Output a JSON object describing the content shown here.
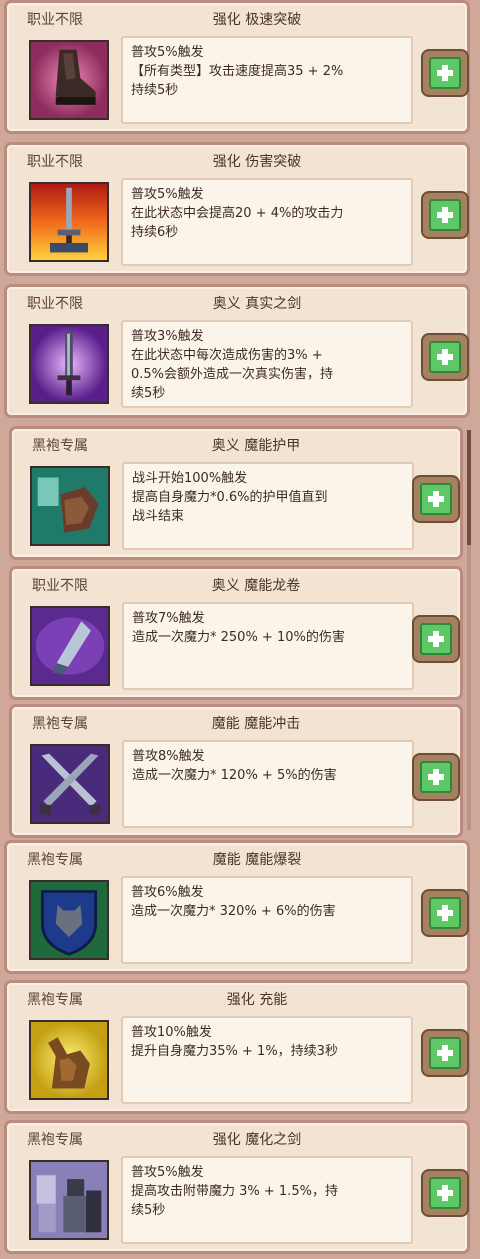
{
  "skills": [
    {
      "class_label": "职业不限",
      "title": "强化 极速突破",
      "desc": "普攻5%触发\n【所有类型】攻击速度提高35 + 2%\n持续5秒",
      "icon": "boot-icon",
      "add_label": "+"
    },
    {
      "class_label": "职业不限",
      "title": "强化 伤害突破",
      "desc": "普攻5%触发\n在此状态中会提高20 + 4%的攻击力\n持续6秒",
      "icon": "sword-in-fire-icon",
      "add_label": "+"
    },
    {
      "class_label": "职业不限",
      "title": "奥义 真实之剑",
      "desc": "普攻3%触发\n在此状态中每次造成伤害的3% +\n0.5%会额外造成一次真实伤害，持\n续5秒",
      "icon": "glowing-sword-icon",
      "add_label": "+"
    },
    {
      "class_label": "黑袍专属",
      "title": "奥义 魔能护甲",
      "desc": "战斗开始100%触发\n提高自身魔力*0.6%的护甲值直到\n战斗结束",
      "icon": "magic-armor-icon",
      "add_label": "+"
    },
    {
      "class_label": "职业不限",
      "title": "奥义 魔能龙卷",
      "desc": "普攻7%触发\n造成一次魔力* 250% + 10%的伤害",
      "icon": "tornado-crystal-icon",
      "add_label": "+"
    },
    {
      "class_label": "黑袍专属",
      "title": "魔能 魔能冲击",
      "desc": "普攻8%触发\n造成一次魔力* 120% + 5%的伤害",
      "icon": "crossed-swords-icon",
      "add_label": "+"
    },
    {
      "class_label": "黑袍专属",
      "title": "魔能 魔能爆裂",
      "desc": "普攻6%触发\n造成一次魔力* 320% + 6%的伤害",
      "icon": "wolf-shield-icon",
      "add_label": "+"
    },
    {
      "class_label": "黑袍专属",
      "title": "强化 充能",
      "desc": "普攻10%触发\n提升自身魔力35% + 1%，持续3秒",
      "icon": "flexing-arm-icon",
      "add_label": "+"
    },
    {
      "class_label": "黑袍专属",
      "title": "强化 魔化之剑",
      "desc": "普攻5%触发\n提高攻击附带魔力 3% + 1.5%，持\n续5秒",
      "icon": "knight-party-icon",
      "add_label": "+"
    }
  ]
}
